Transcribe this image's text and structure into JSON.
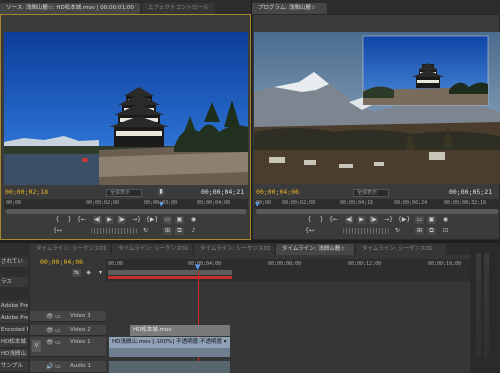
{
  "source_monitor": {
    "tab_label": "ソース: 浅間山麓☆: HD松本城.mov | 00;00;01;00",
    "effect_tab_label": "エフェクトコントロール",
    "current_timecode": "00;00;02;18",
    "fit_label": "全体表示",
    "duration_timecode": "00;00;04;21",
    "ruler": [
      "00;00",
      "00;00;02;00",
      "00;00;03;00",
      "00;00;04;00"
    ]
  },
  "program_monitor": {
    "tab_label": "プログラム: 浅間山麓☆",
    "current_timecode": "00;00;04;06",
    "fit_label": "全体表示",
    "duration_timecode": "00;00;05;21",
    "ruler": [
      "00;00",
      "00;00;02;08",
      "00;00;04;16",
      "00;00;06;24",
      "00;00;08;32",
      "00;00;08;32;16"
    ]
  },
  "timeline": {
    "tabs": [
      "タイムライン: シーケンス01",
      "タイムライン: シーケンス01",
      "タイムライン: シーケンス01",
      "タイムライン: 浅間山麓☆",
      "タイムライン: シーケンス01"
    ],
    "active_tab_index": 3,
    "current_timecode": "00;00;04;06",
    "ruler": [
      "00;00",
      "00;00;04;00",
      "00;00;08;00",
      "00;00;12;00",
      "00;00;16;00"
    ],
    "tracks": [
      {
        "name": "Video 3"
      },
      {
        "name": "Video 2"
      },
      {
        "name": "Video 1"
      },
      {
        "name": "Audio 1"
      }
    ],
    "clip_video2": "HD松本城.mov",
    "clip_video1": "HD浅間山.mov [-100%]  不透明度:不透明度 ▾"
  },
  "project_panel": {
    "items": [
      "されてい",
      "ラス",
      "Adobe Pre",
      "Adobe Pre",
      "Encoded F",
      "HD松本城.",
      "HD浅間山.",
      "サンプル"
    ]
  },
  "colors": {
    "timecode_yellow": "#e8b325",
    "playhead_red": "#d02a2a",
    "selected_border": "#a9872f",
    "sky_blue": "#1b4fa5"
  }
}
